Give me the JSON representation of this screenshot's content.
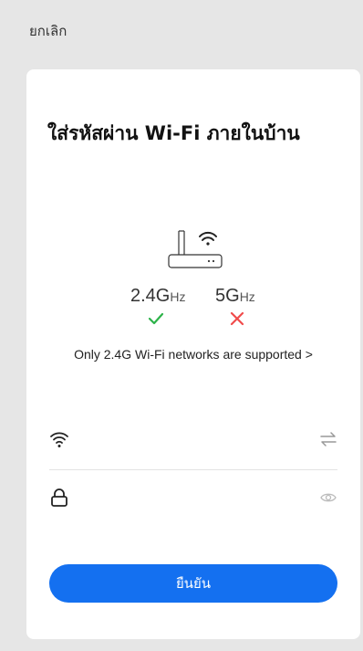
{
  "header": {
    "cancel_label": "ยกเลิก"
  },
  "card": {
    "title": "ใส่รหัสผ่าน Wi-Fi ภายในบ้าน",
    "bands": {
      "band_24": {
        "value": "2.4G",
        "unit": "Hz",
        "supported": true
      },
      "band_5": {
        "value": "5G",
        "unit": "Hz",
        "supported": false
      }
    },
    "support_note": "Only 2.4G Wi-Fi networks are supported >",
    "wifi_field": {
      "icon": "wifi-icon",
      "value": "",
      "placeholder": "",
      "action_icon": "switch-arrows-icon"
    },
    "password_field": {
      "icon": "lock-icon",
      "value": "",
      "placeholder": "",
      "action_icon": "eye-icon"
    },
    "confirm_label": "ยืนยัน"
  },
  "colors": {
    "background": "#e6e6e6",
    "card": "#ffffff",
    "accent": "#1470f0",
    "supported": "#2db34a",
    "unsupported": "#f04b4b"
  }
}
